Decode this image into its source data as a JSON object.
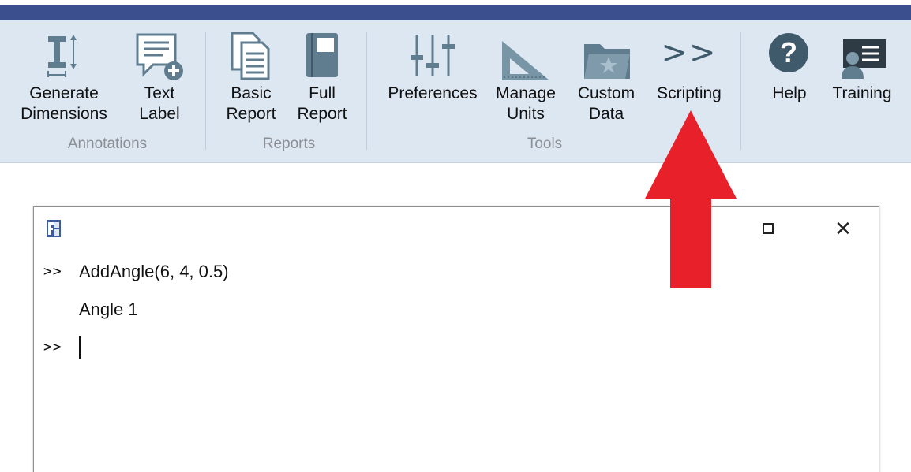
{
  "ribbon": {
    "groups": [
      {
        "label": "Annotations"
      },
      {
        "label": "Reports"
      },
      {
        "label": "Tools"
      }
    ],
    "buttons": {
      "generate_dimensions": "Generate\nDimensions",
      "text_label": "Text\nLabel",
      "basic_report": "Basic\nReport",
      "full_report": "Full\nReport",
      "preferences": "Preferences",
      "manage_units": "Manage\nUnits",
      "custom_data": "Custom\nData",
      "scripting": "Scripting",
      "help": "Help",
      "training": "Training"
    },
    "scripting_icon_glyph": ">>",
    "help_icon_glyph": "?"
  },
  "script_window": {
    "close_glyph": "✕",
    "lines": [
      {
        "prompt": ">>",
        "text": "AddAngle(6, 4, 0.5)"
      },
      {
        "prompt": "",
        "text": "Angle 1"
      },
      {
        "prompt": ">>",
        "text": ""
      }
    ]
  },
  "colors": {
    "ribbon_background": "#dde7f2",
    "title_bar": "#3b4f8f",
    "icon_steel": "#5f7d8f",
    "arrow_red": "#e8202a"
  }
}
